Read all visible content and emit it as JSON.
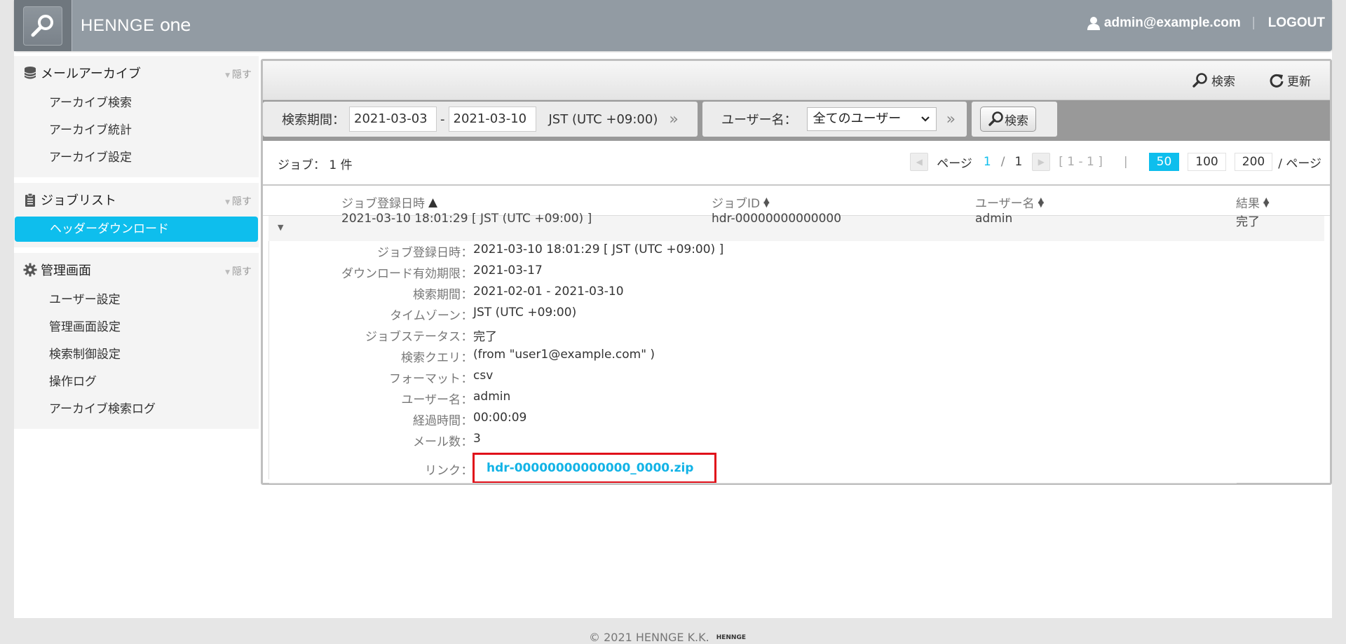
{
  "header": {
    "brand_main": "HENNGE ",
    "brand_suffix": "one",
    "user_email": "admin@example.com",
    "separator": "|",
    "logout_label": "LOGOUT"
  },
  "sidebar": {
    "hide_label": "隠す",
    "sections": [
      {
        "title": "メールアーカイブ",
        "items": [
          "アーカイブ検索",
          "アーカイブ統計",
          "アーカイブ設定"
        ]
      },
      {
        "title": "ジョブリスト",
        "items": [
          "ヘッダーダウンロード"
        ]
      },
      {
        "title": "管理画面",
        "items": [
          "ユーザー設定",
          "管理画面設定",
          "検索制御設定",
          "操作ログ",
          "アーカイブ検索ログ"
        ]
      }
    ]
  },
  "toolbar": {
    "search_label": "検索",
    "refresh_label": "更新"
  },
  "filter": {
    "period_label": "検索期間：",
    "date_from": "2021-03-03",
    "date_dash": "-",
    "date_to": "2021-03-10",
    "timezone": "JST (UTC +09:00)",
    "user_label": "ユーザー名：",
    "user_select": "全てのユーザー",
    "search_button": "検索",
    "chevron": "»"
  },
  "count": {
    "label": "ジョブ： 1 件"
  },
  "pager": {
    "page_label": "ページ",
    "current": "1",
    "slash": "/",
    "total": "1",
    "range": "[ 1 - 1 ]",
    "divider": "|",
    "sizes": [
      "50",
      "100",
      "200"
    ],
    "active_size": "50",
    "per_page_label": "/ ページ"
  },
  "table": {
    "headers": {
      "date": "ジョブ登録日時",
      "job_id": "ジョブID",
      "user": "ユーザー名",
      "result": "結果"
    },
    "row": {
      "date": "2021-03-10 18:01:29 [ JST (UTC +09:00) ]",
      "job_id": "hdr-00000000000000",
      "user": "admin",
      "result": "完了"
    }
  },
  "detail": [
    {
      "key": "ジョブ登録日時",
      "value": "2021-03-10 18:01:29 [ JST (UTC +09:00) ]"
    },
    {
      "key": "ダウンロード有効期限",
      "value": "2021-03-17"
    },
    {
      "key": "検索期間",
      "value": "2021-02-01 - 2021-03-10"
    },
    {
      "key": "タイムゾーン",
      "value": "JST (UTC +09:00)"
    },
    {
      "key": "ジョブステータス",
      "value": "完了"
    },
    {
      "key": "検索クエリ",
      "value": "(from \"user1@example.com\" )"
    },
    {
      "key": "フォーマット",
      "value": "csv"
    },
    {
      "key": "ユーザー名",
      "value": "admin"
    },
    {
      "key": "経過時間",
      "value": "00:00:09"
    },
    {
      "key": "メール数",
      "value": "3"
    }
  ],
  "link": {
    "key": "リンク",
    "value": "hdr-00000000000000_0000.zip"
  },
  "colon": "：",
  "footer": {
    "copyright": "© 2021 HENNGE K.K.",
    "mini_logo": "HENNGE"
  },
  "colors": {
    "accent": "#0ebeed",
    "header": "#929ba3",
    "highlight_box": "#e0101a",
    "link": "#12b3e6"
  }
}
